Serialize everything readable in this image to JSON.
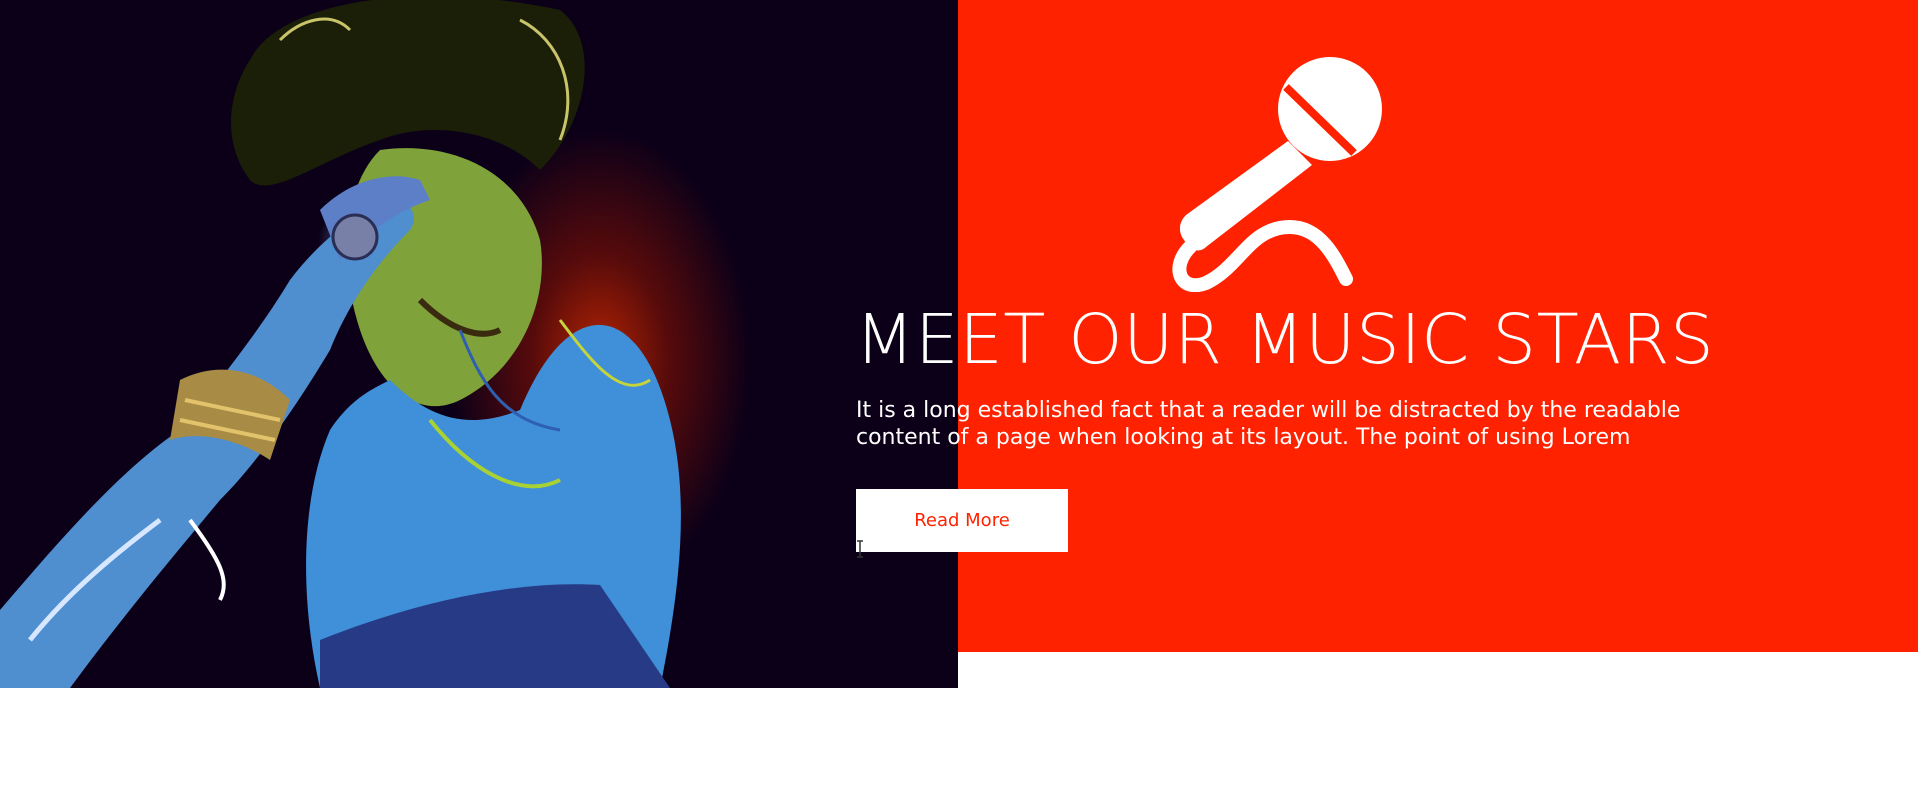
{
  "hero": {
    "title": "MEET OUR MUSIC STARS",
    "description": "It is a long established fact that a reader will be distracted by the readable content of a page when looking at its layout. The point of using Lorem",
    "button_label": "Read More",
    "icon": "microphone-icon",
    "image": "singer-portrait"
  },
  "colors": {
    "accent": "#ff2200",
    "text_on_accent": "#ffffff",
    "button_background": "#ffffff",
    "photo_background": "#0c0018"
  }
}
